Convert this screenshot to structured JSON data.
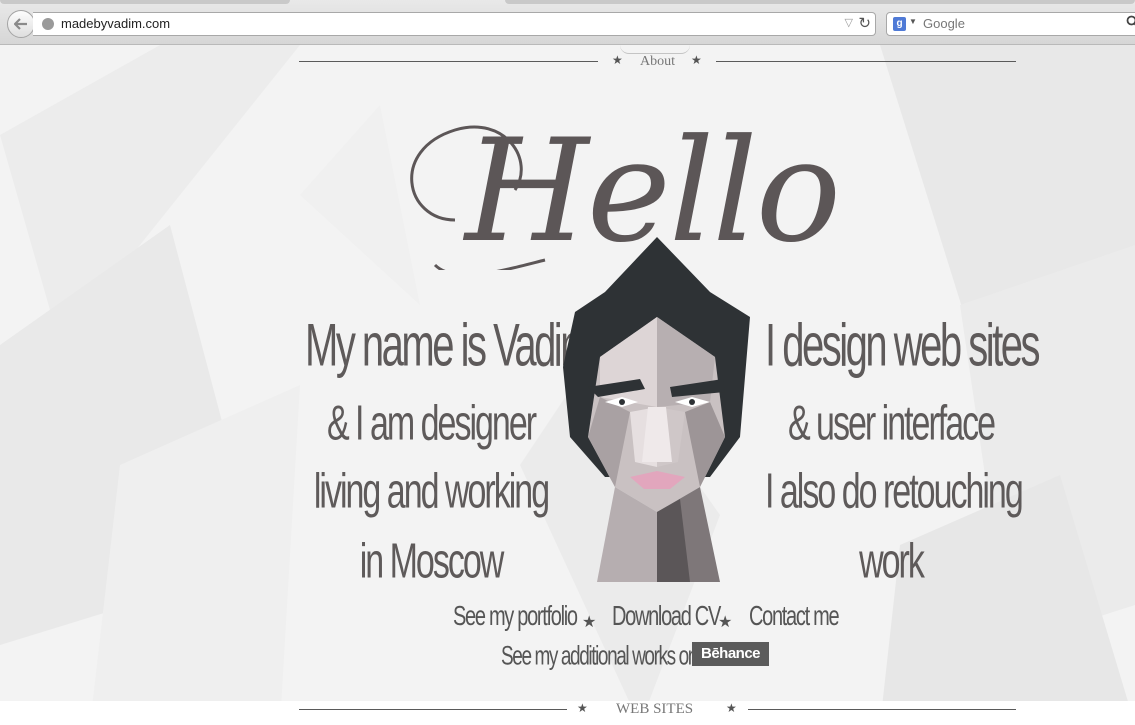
{
  "browser": {
    "url": "madebyvadim.com",
    "search_placeholder": "Google"
  },
  "page": {
    "about_label": "About",
    "hello_title": "Hello",
    "left_lines": [
      "My name is Vadim",
      "& I am designer",
      "living and working",
      "in Moscow"
    ],
    "right_lines": [
      "I design web sites",
      "& user interface",
      "I also do retouching",
      "work"
    ],
    "links": {
      "portfolio": "See my portfolio",
      "cv": "Download CV",
      "contact": "Contact me",
      "additional": "See my additional works on",
      "behance": "Bēhance"
    },
    "websites_label": "WEB SITES",
    "star_glyph": "★"
  },
  "colors": {
    "text": "#5e5a5a",
    "hood": "#2e3235",
    "background": "#f3f3f3"
  }
}
